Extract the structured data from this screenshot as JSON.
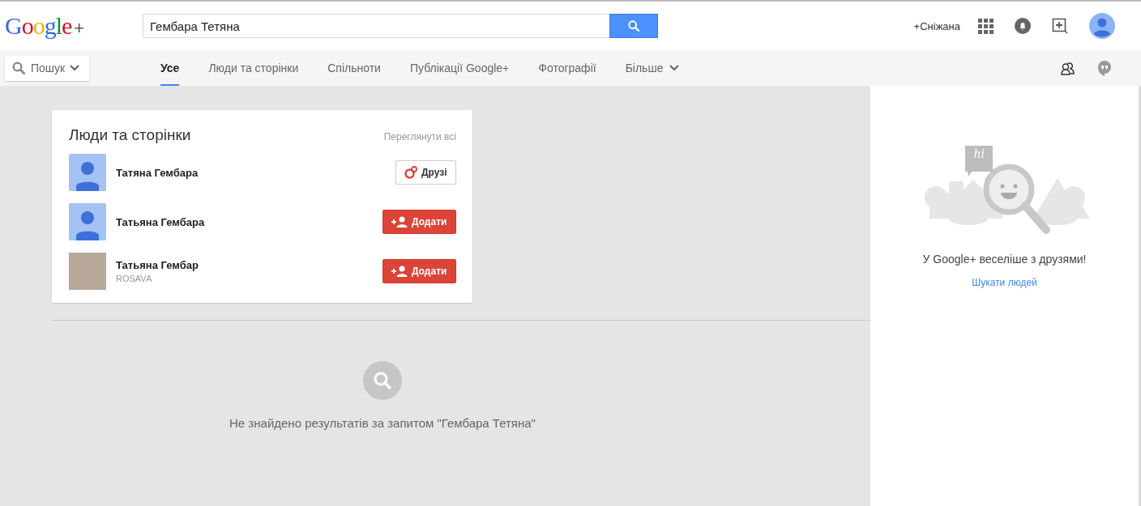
{
  "header": {
    "logo": "Google",
    "logo_plus": "+",
    "search": {
      "value": "Гембара Тетяна"
    },
    "user_link": "+Сніжана"
  },
  "nav": {
    "filter": "Пошук",
    "tabs": [
      {
        "label": "Усе",
        "selected": true,
        "dropdown": false
      },
      {
        "label": "Люди та сторінки",
        "selected": false,
        "dropdown": false
      },
      {
        "label": "Спільноти",
        "selected": false,
        "dropdown": false
      },
      {
        "label": "Публікації Google+",
        "selected": false,
        "dropdown": false
      },
      {
        "label": "Фотографії",
        "selected": false,
        "dropdown": false
      },
      {
        "label": "Більше",
        "selected": false,
        "dropdown": true
      }
    ]
  },
  "people_card": {
    "title": "Люди та сторінки",
    "view_all": "Переглянути всі",
    "people": [
      {
        "name": "Татяна Гембара",
        "avatar": {
          "kind": "placeholder"
        },
        "button": {
          "kind": "friends",
          "label": "Друзі"
        }
      },
      {
        "name": "Татьяна Гембара",
        "avatar": {
          "kind": "placeholder"
        },
        "button": {
          "kind": "add",
          "label": "Додати"
        }
      },
      {
        "name": "Татьяна Гембар",
        "subtitle": "ROSAVA",
        "avatar": {
          "kind": "photo"
        },
        "button": {
          "kind": "add",
          "label": "Додати"
        }
      }
    ]
  },
  "empty_state": {
    "message": "Не знайдено результатів за запитом \"Гембара Тетяна\""
  },
  "sidebar": {
    "illustration_text": "hi",
    "message": "У Google+ веселіше з друзями!",
    "link": "Шукати людей"
  }
}
